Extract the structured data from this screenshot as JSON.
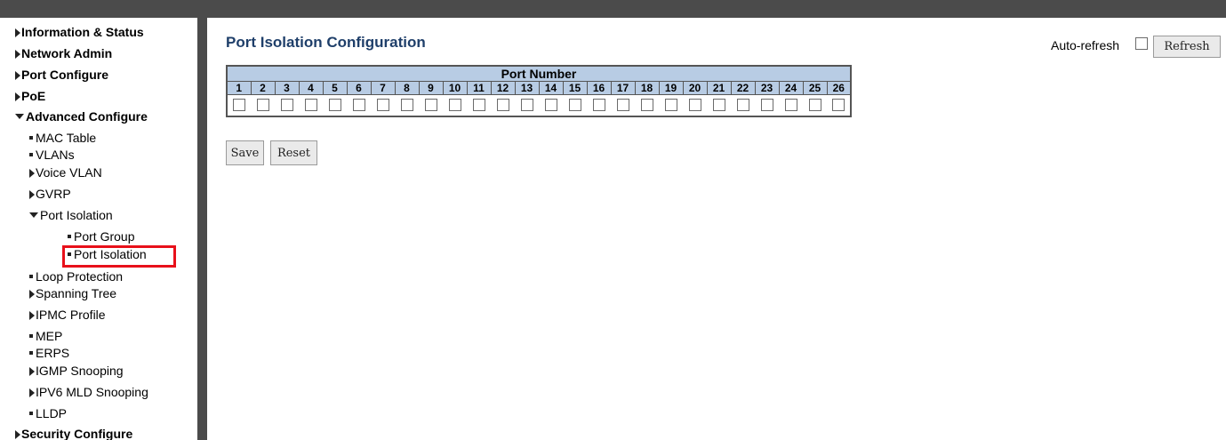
{
  "sidebar": {
    "items": [
      {
        "label": "Information & Status",
        "level": "top",
        "icon": "arrow-right"
      },
      {
        "label": "Network Admin",
        "level": "top",
        "icon": "arrow-right"
      },
      {
        "label": "Port Configure",
        "level": "top",
        "icon": "arrow-right"
      },
      {
        "label": "PoE",
        "level": "top",
        "icon": "arrow-right"
      },
      {
        "label": "Advanced Configure",
        "level": "top",
        "icon": "arrow-down"
      },
      {
        "label": "MAC Table",
        "level": "sub",
        "icon": "bullet"
      },
      {
        "label": "VLANs",
        "level": "sub",
        "icon": "bullet"
      },
      {
        "label": "Voice VLAN",
        "level": "sub",
        "icon": "arrow-right"
      },
      {
        "label": "GVRP",
        "level": "sub",
        "icon": "arrow-right"
      },
      {
        "label": "Port Isolation",
        "level": "sub",
        "icon": "arrow-down"
      },
      {
        "label": "Port Group",
        "level": "subsub",
        "icon": "bullet"
      },
      {
        "label": "Port Isolation",
        "level": "subsub",
        "icon": "bullet",
        "selected": true
      },
      {
        "label": "Loop Protection",
        "level": "sub",
        "icon": "bullet"
      },
      {
        "label": "Spanning Tree",
        "level": "sub",
        "icon": "arrow-right"
      },
      {
        "label": "IPMC Profile",
        "level": "sub",
        "icon": "arrow-right"
      },
      {
        "label": "MEP",
        "level": "sub",
        "icon": "bullet"
      },
      {
        "label": "ERPS",
        "level": "sub",
        "icon": "bullet"
      },
      {
        "label": "IGMP Snooping",
        "level": "sub",
        "icon": "arrow-right"
      },
      {
        "label": "IPV6 MLD Snooping",
        "level": "sub",
        "icon": "arrow-right"
      },
      {
        "label": "LLDP",
        "level": "sub",
        "icon": "bullet"
      },
      {
        "label": "Security Configure",
        "level": "top",
        "icon": "arrow-right"
      }
    ]
  },
  "main": {
    "title": "Port Isolation Configuration",
    "auto_refresh_label": "Auto-refresh",
    "refresh_label": "Refresh",
    "table_header": "Port Number",
    "ports": [
      "1",
      "2",
      "3",
      "4",
      "5",
      "6",
      "7",
      "8",
      "9",
      "10",
      "11",
      "12",
      "13",
      "14",
      "15",
      "16",
      "17",
      "18",
      "19",
      "20",
      "21",
      "22",
      "23",
      "24",
      "25",
      "26"
    ],
    "save_label": "Save",
    "reset_label": "Reset"
  },
  "colors": {
    "header_bg": "#b8cce4",
    "title": "#1f3f6a",
    "highlight": "#e8101a",
    "frame": "#4b4b4b"
  }
}
